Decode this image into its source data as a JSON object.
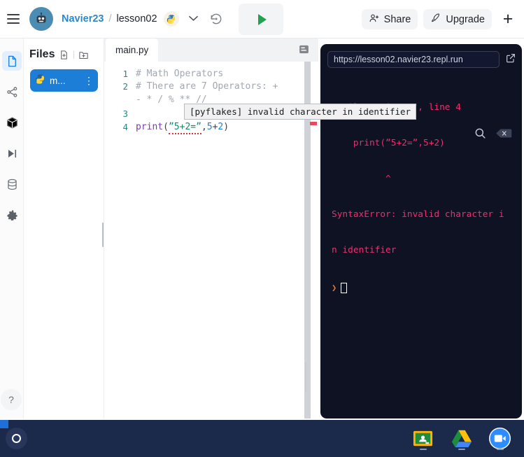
{
  "header": {
    "menu_icon": "hamburger-icon",
    "avatar_icon": "robot-avatar",
    "username": "Navier23",
    "separator": "/",
    "project": "lesson02",
    "language_icon": "python-logo",
    "chevron": "⌄",
    "history_icon": "history-icon",
    "run_icon": "play-triangle-icon",
    "share_label": "Share",
    "share_icon": "person-plus-icon",
    "upgrade_label": "Upgrade",
    "upgrade_icon": "rocket-icon",
    "new_label": "+"
  },
  "rail": {
    "items": [
      {
        "name": "files-tool",
        "icon": "file-icon",
        "active": true
      },
      {
        "name": "version-control-tool",
        "icon": "git-branch-icon",
        "active": false
      },
      {
        "name": "packages-tool",
        "icon": "package-box-icon",
        "active": false
      },
      {
        "name": "debugger-tool",
        "icon": "debug-step-icon",
        "active": false
      },
      {
        "name": "database-tool",
        "icon": "database-icon",
        "active": false
      },
      {
        "name": "settings-tool",
        "icon": "gear-icon",
        "active": false
      }
    ],
    "help_label": "?"
  },
  "files": {
    "title": "Files",
    "add_file_icon": "new-file-icon",
    "add_folder_icon": "new-folder-icon",
    "items": [
      {
        "name": "main.py",
        "display": "m...",
        "icon": "python-file-icon",
        "selected": true,
        "menu": "⋮"
      }
    ]
  },
  "editor": {
    "tab_label": "main.py",
    "panel_icon": "layout-panel-icon",
    "lines": [
      {
        "num": "1",
        "text": "# Math Operators"
      },
      {
        "num": "2",
        "text": "# There are 7 Operators: +"
      },
      {
        "num": "",
        "text": "- * / % ** //"
      },
      {
        "num": "3",
        "text": ""
      },
      {
        "num": "4",
        "text": "print(ˮ5+2=ˮ,5+2)"
      }
    ],
    "code_tokens": {
      "func": "print",
      "string": "ˮ5+2=ˮ",
      "arg_a": "5",
      "arg_b": "2",
      "plus": "+"
    }
  },
  "tooltip": {
    "text": "[pyflakes] invalid character in identifier"
  },
  "console": {
    "url": "https://lesson02.navier23.repl.run",
    "external_icon": "external-link-icon",
    "search_icon": "search-icon",
    "clear_icon": "clear-console-icon",
    "output": [
      "  File \"main.py\", line 4",
      "    print(ˮ5+2=ˮ,5+2)",
      "          ^",
      "SyntaxError: invalid character i",
      "n identifier"
    ],
    "prompt": "❯",
    "cursor": ""
  },
  "taskbar": {
    "launcher_icon": "chromeos-launcher-icon",
    "tray": [
      {
        "name": "google-classroom-icon"
      },
      {
        "name": "google-drive-icon"
      },
      {
        "name": "zoom-icon"
      }
    ]
  },
  "colors": {
    "accent_blue": "#1c7ed6",
    "run_green": "#23a24d",
    "error_pink": "#ef2d6d",
    "console_bg": "#0e1222",
    "taskbar_bg": "#1b2a4a"
  }
}
